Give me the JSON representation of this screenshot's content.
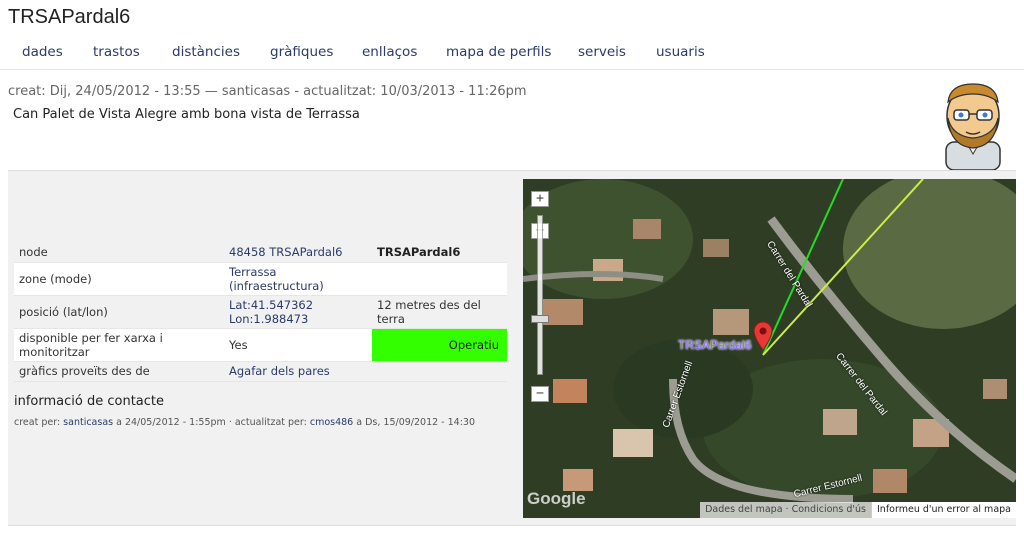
{
  "site": {
    "title": "TRSAPardal6"
  },
  "nav": {
    "items": [
      "dades",
      "trastos",
      "distàncies",
      "gràfiques",
      "enllaços",
      "mapa de perfils",
      "serveis",
      "usuaris"
    ]
  },
  "header": {
    "meta": "creat: Dij, 24/05/2012 - 13:55 — santicasas - actualitzat: 10/03/2013 - 11:26pm",
    "description": "Can Palet de Vista Alegre amb bona vista de Terrassa"
  },
  "info_table": {
    "rows": [
      {
        "label": "node",
        "value": "48458 TRSAPardal6",
        "extra": "TRSAPardal6"
      },
      {
        "label": "zone (mode)",
        "value": "Terrassa (infraestructura)",
        "extra": ""
      },
      {
        "label": "posició (lat/lon)",
        "lat": "Lat:41.547362",
        "lon": "Lon:1.988473",
        "extra": "12 metres des del terra"
      },
      {
        "label": "disponible per fer xarxa i monitoritzar",
        "value": "Yes",
        "extra": "Operatiu"
      },
      {
        "label": "gràfics proveïts des de",
        "value": "Agafar dels pares",
        "extra": ""
      }
    ]
  },
  "contact": {
    "title": "informació de contacte",
    "prefix1": "creat per: ",
    "user1": "santicasas",
    "mid": " a 24/05/2012 - 1:55pm · actualitzat per: ",
    "user2": "cmos486",
    "suffix": " a Ds, 15/09/2012 - 14:30"
  },
  "map": {
    "marker_label": "TRSAPardal6",
    "zoom_in": "+",
    "zoom_out": "−",
    "streets": [
      "Carrer del Pardal",
      "Carrer del Pardal",
      "Carrer Estornell",
      "Carrer Estornell"
    ],
    "logo": "Google",
    "footer_data": "Dades del mapa · Condicions d'ús",
    "footer_report": "Informeu d'un error al mapa"
  },
  "colors": {
    "status_ok": "#33ff00",
    "link": "#2b3a6b",
    "link_green": "#22dd22",
    "link_yellow": "#ccee44"
  }
}
